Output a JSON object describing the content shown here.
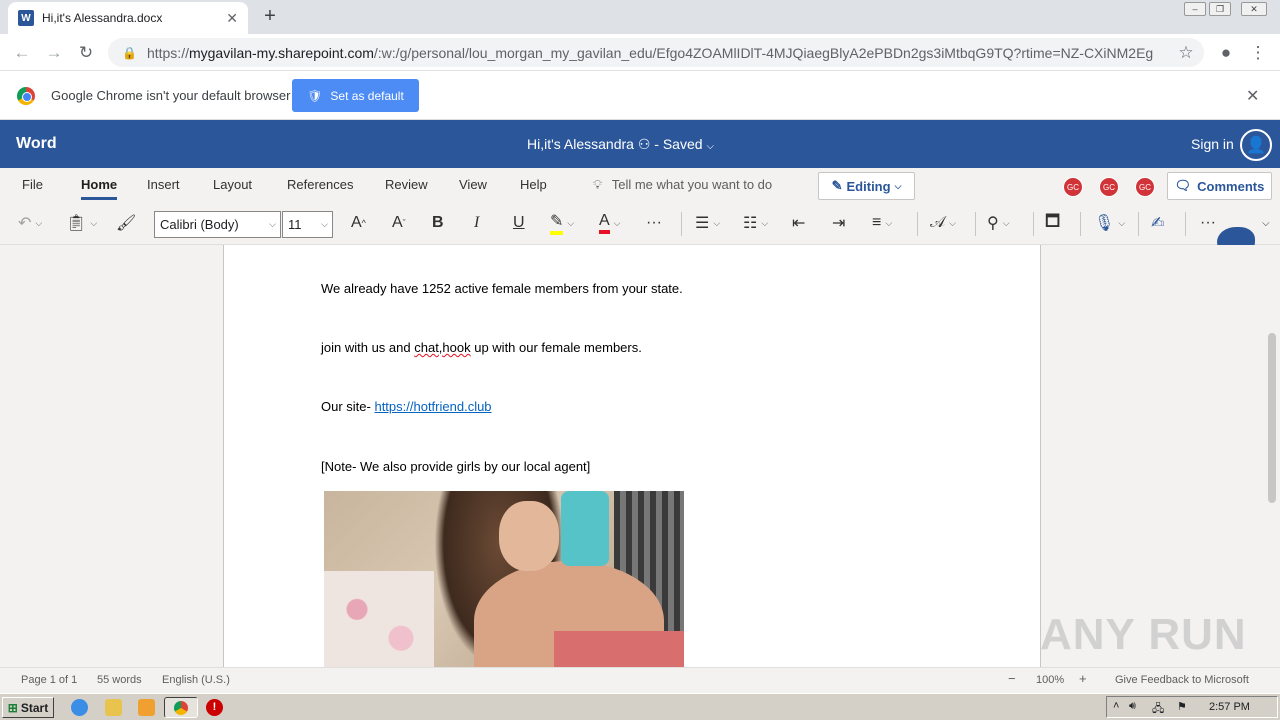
{
  "browser": {
    "tab_title": "Hi,it's Alessandra.docx",
    "tab_icon": "word-icon",
    "url_domain": "mygavilan-my.sharepoint.com",
    "url_prefix": "https://",
    "url_path": "/:w:/g/personal/lou_morgan_my_gavilan_edu/Efgo4ZOAMlIDlT-4MJQiaegBlyA2ePBDn2gs3iMtbqG9TQ?rtime=NZ-CXiNM2Eg"
  },
  "infobar": {
    "message": "Google Chrome isn't your default browser",
    "button": "Set as default"
  },
  "word": {
    "app_name": "Word",
    "doc_title": "Hi,it's Alessandra",
    "save_status": "Saved",
    "sign_in": "Sign in"
  },
  "ribbon": {
    "tabs": [
      "File",
      "Home",
      "Insert",
      "Layout",
      "References",
      "Review",
      "View",
      "Help"
    ],
    "active_tab": "Home",
    "tell_me": "Tell me what you want to do",
    "editing": "Editing",
    "comments": "Comments",
    "collaborators": [
      "GC",
      "GC",
      "GC"
    ],
    "font_name": "Calibri (Body)",
    "font_size": "11"
  },
  "document": {
    "p1": "We already have 1252 active female members from your state.",
    "p2_before": "join with us and ",
    "p2_squig": "chat,hook",
    "p2_after": " up with our female members.",
    "p3_label": "Our site- ",
    "p3_link": "https://hotfriend.club",
    "p4": "[Note- We also provide girls by our local agent]"
  },
  "status": {
    "page": "Page 1 of 1",
    "words": "55 words",
    "language": "English (U.S.)",
    "zoom": "100%",
    "feedback": "Give Feedback to Microsoft"
  },
  "taskbar": {
    "start": "Start",
    "time": "2:57 PM"
  },
  "watermark": "ANY RUN",
  "colors": {
    "word_blue": "#2b579a",
    "link": "#0563c1",
    "collab": "#d13438"
  }
}
